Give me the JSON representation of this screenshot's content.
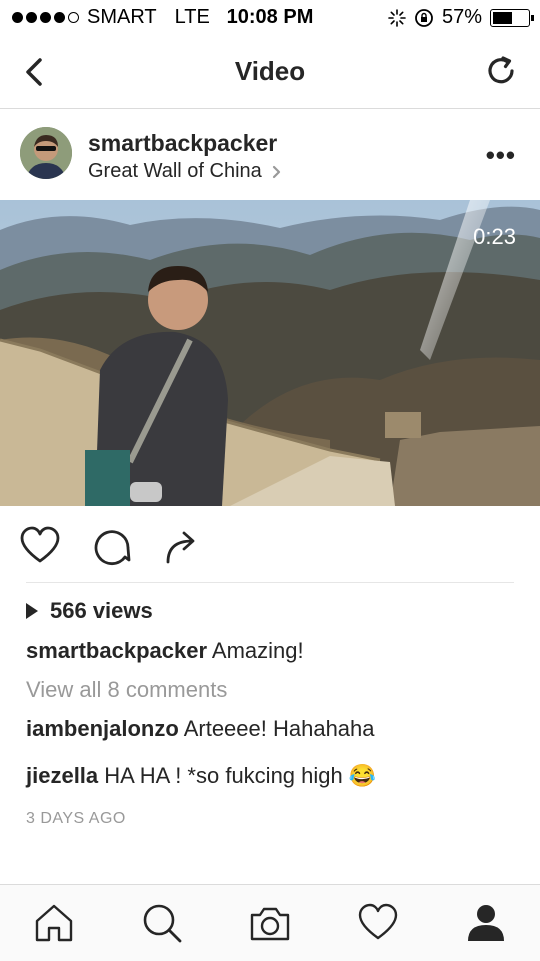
{
  "status_bar": {
    "carrier": "SMART",
    "network": "LTE",
    "time": "10:08 PM",
    "battery": "57%",
    "battery_level": 0.57
  },
  "nav": {
    "title": "Video",
    "back_icon": "chevron-left-icon",
    "refresh_icon": "refresh-icon"
  },
  "post": {
    "username": "smartbackpacker",
    "location": "Great Wall of China",
    "video_duration": "0:23",
    "views": "566 views",
    "caption_user": "smartbackpacker",
    "caption_text": "Amazing!",
    "view_all": "View all 8 comments",
    "comments": [
      {
        "user": "iambenjalonzo",
        "text": "Arteeee! Hahahaha"
      },
      {
        "user": "jiezella",
        "text": "HA HA ! *so fukcing high 😂"
      }
    ],
    "time_ago": "3 DAYS AGO"
  },
  "tabs": [
    "home-icon",
    "search-icon",
    "camera-icon",
    "heart-icon",
    "profile-icon"
  ]
}
